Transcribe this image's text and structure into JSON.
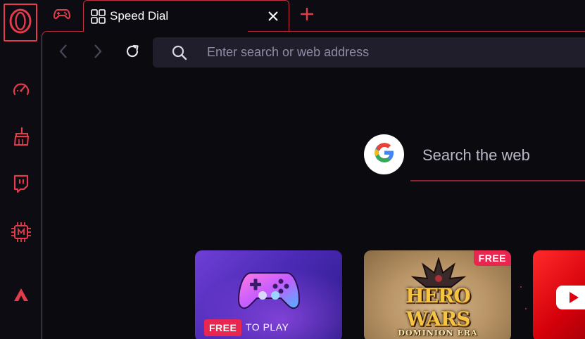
{
  "tabs": {
    "active_title": "Speed Dial"
  },
  "address_bar": {
    "placeholder": "Enter search or web address"
  },
  "web_search": {
    "label": "Search the web"
  },
  "tiles": {
    "games": {
      "badge": "FREE",
      "caption": "TO PLAY"
    },
    "hero_wars": {
      "badge": "FREE",
      "title": "HERO WARS",
      "subtitle": "DOMINION ERA"
    }
  },
  "colors": {
    "accent": "#e23b4c",
    "frame": "#c23142",
    "badge": "#e8264f",
    "address_bg": "#201e2b"
  },
  "icons": {
    "sidebar": [
      "opera-logo-icon",
      "speedometer-icon",
      "cleaner-icon",
      "twitch-icon",
      "memory-chip-icon",
      "aria-icon"
    ],
    "tabbar": [
      "gamepad-icon",
      "grid-icon",
      "close-icon",
      "plus-icon"
    ],
    "nav": [
      "back-icon",
      "forward-icon",
      "reload-icon",
      "search-icon"
    ]
  }
}
